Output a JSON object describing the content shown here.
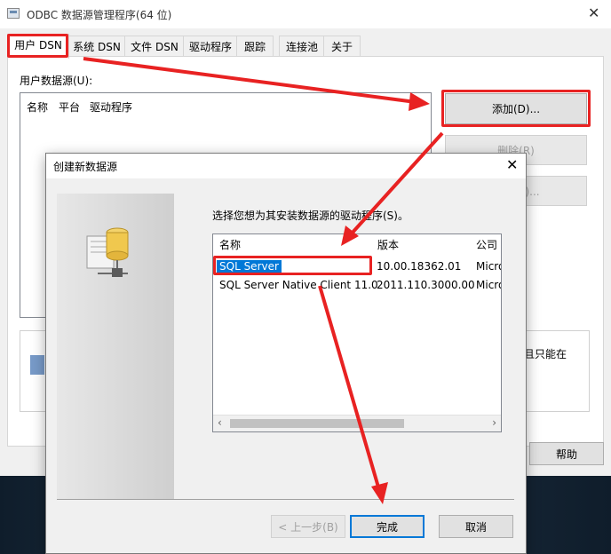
{
  "window": {
    "title": "ODBC 数据源管理程序(64 位)",
    "close_glyph": "✕"
  },
  "tabs": [
    "用户 DSN",
    "系统 DSN",
    "文件 DSN",
    "驱动程序",
    "跟踪",
    "连接池",
    "关于"
  ],
  "user_dsn": {
    "list_label": "用户数据源(U):",
    "columns": [
      "名称",
      "平台",
      "驱动程序"
    ],
    "add_button": "添加(D)...",
    "delete_button": "删除(R)",
    "configure_button": "配置(C)...",
    "help_button": "帮助",
    "info_text": "且只能在"
  },
  "dialog": {
    "title": "创建新数据源",
    "close_glyph": "✕",
    "prompt": "选择您想为其安装数据源的驱动程序(S)。",
    "columns": [
      "名称",
      "版本",
      "公司"
    ],
    "drivers": [
      {
        "name": "SQL Server",
        "version": "10.00.18362.01",
        "company": "Micro"
      },
      {
        "name": "SQL Server Native Client 11.0",
        "version": "2011.110.3000.00",
        "company": "Micro"
      }
    ],
    "scroll_left": "‹",
    "scroll_right": "›",
    "back_button": "< 上一步(B)",
    "finish_button": "完成",
    "cancel_button": "取消"
  },
  "colors": {
    "highlight": "#e82222",
    "selection": "#0078d7"
  }
}
